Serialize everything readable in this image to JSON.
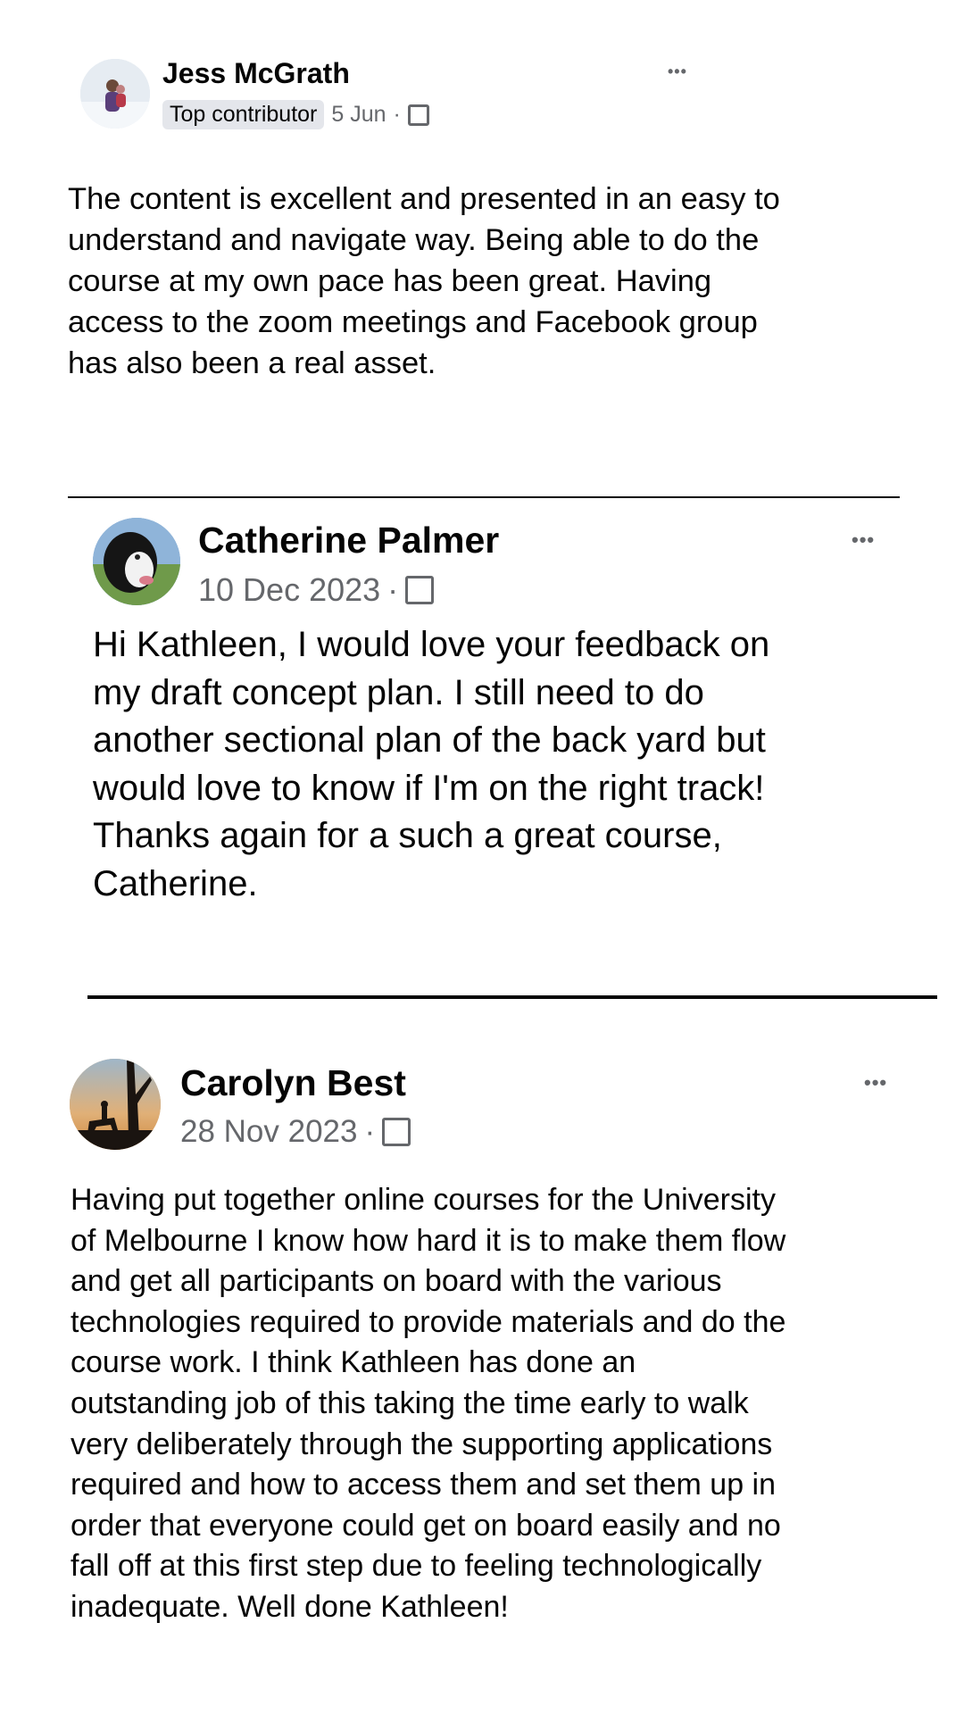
{
  "posts": [
    {
      "author": "Jess McGrath",
      "badge": "Top contributor",
      "date": "5 Jun",
      "separator": "·",
      "more": "•••",
      "audience_icon": "group-audience-icon",
      "body": "The content is excellent and presented in an easy to\nunderstand and navigate way. Being able to do the\ncourse at my own pace has been great. Having\naccess to the zoom meetings and Facebook group\nhas also been a real asset."
    },
    {
      "author": "Catherine Palmer",
      "date": "10 Dec 2023",
      "separator": "·",
      "more": "•••",
      "audience_icon": "group-audience-icon",
      "body": "Hi Kathleen, I would love your feedback on\nmy draft concept plan. I still need to do\nanother sectional plan of the back yard but\nwould love to know if I'm on the right track!\nThanks again for a such a great course,\nCatherine."
    },
    {
      "author": "Carolyn Best",
      "date": "28 Nov 2023",
      "separator": "·",
      "more": "•••",
      "audience_icon": "group-audience-icon",
      "body": "Having put together online courses for the University\nof Melbourne I know how hard it is to make them flow\nand get all participants on board with the various\ntechnologies required to provide materials and do the\ncourse work. I think Kathleen has done an\noutstanding job of this taking the time early to walk\nvery deliberately through the supporting applications\nrequired and how to access them and set them up in\norder that everyone could get on board easily and no\nfall off at this first step due to feeling technologically\ninadequate. Well done Kathleen!"
    }
  ],
  "colors": {
    "meta_text": "#65676b",
    "badge_bg": "#e4e6eb",
    "text": "#050505"
  }
}
